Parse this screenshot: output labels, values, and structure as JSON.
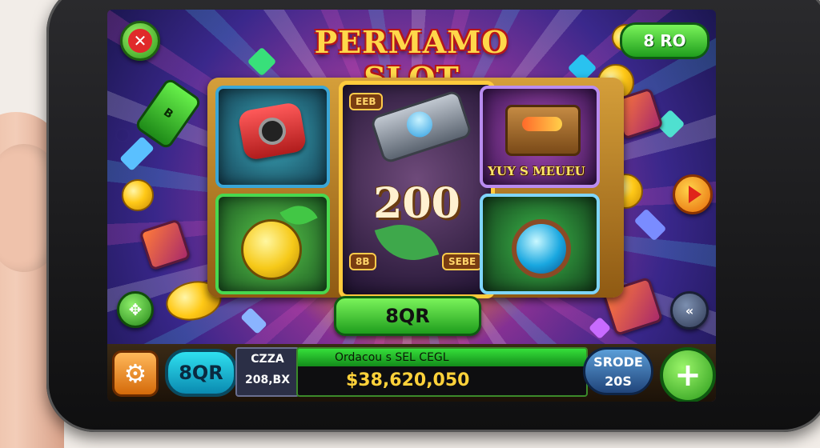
{
  "game": {
    "title": "PERMAMO SLOT",
    "top_badge": "8 RO",
    "close_label": "✕",
    "center_button": "8QR",
    "reel_center_number": "200",
    "reel_center_tag_top": "EEB",
    "reel_center_tag_left": "8B",
    "reel_center_tag_right": "SEBE",
    "reel_top_right_caption": "YUY S MEUEU",
    "bottle_label": "B",
    "side_left_icon": "✥",
    "side_right_icon": "«"
  },
  "bottom_bar": {
    "qr_label": "8QR",
    "label_top": "CZZA",
    "label_bottom": "208,BX",
    "info_top": "Ordacou s SEL CEGL",
    "info_amount": "$38,620,050",
    "count_top": "SRODE",
    "count_bottom": "20S",
    "plus_label": "+",
    "settings_icon": "⚙"
  },
  "colors": {
    "title": "#ffd84a",
    "primary_green": "#2f9a18",
    "amount_gold": "#ffd23a",
    "reel_frame": "#ffcb3c"
  }
}
